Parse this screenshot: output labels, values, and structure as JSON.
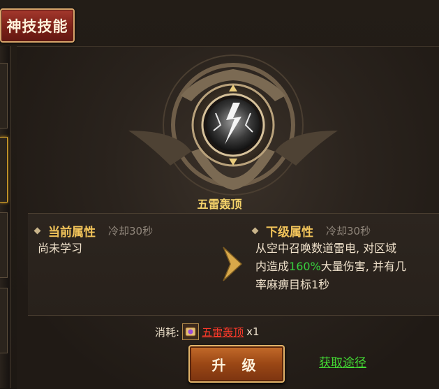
{
  "title_tab": "神技技能",
  "skill": {
    "name": "五雷轰顶"
  },
  "current": {
    "heading": "当前属性",
    "cooldown": "冷却30秒",
    "desc": "尚未学习"
  },
  "next": {
    "heading": "下级属性",
    "cooldown": "冷却30秒",
    "line1": "从空中召唤数道雷电, 对区域",
    "line2_pre": "内造成",
    "line2_hl": "160%",
    "line2_post": "大量伤害, 并有几",
    "line3": "率麻痹目标1秒"
  },
  "cost": {
    "label": "消耗:",
    "item": "五雷轰顶",
    "qty": "x1"
  },
  "upgrade_button": "升 级",
  "get_link": "获取途径",
  "colors": {
    "accent_gold": "#f2c45a",
    "highlight_green": "#37d03e",
    "link_red": "#ff3a2a"
  }
}
